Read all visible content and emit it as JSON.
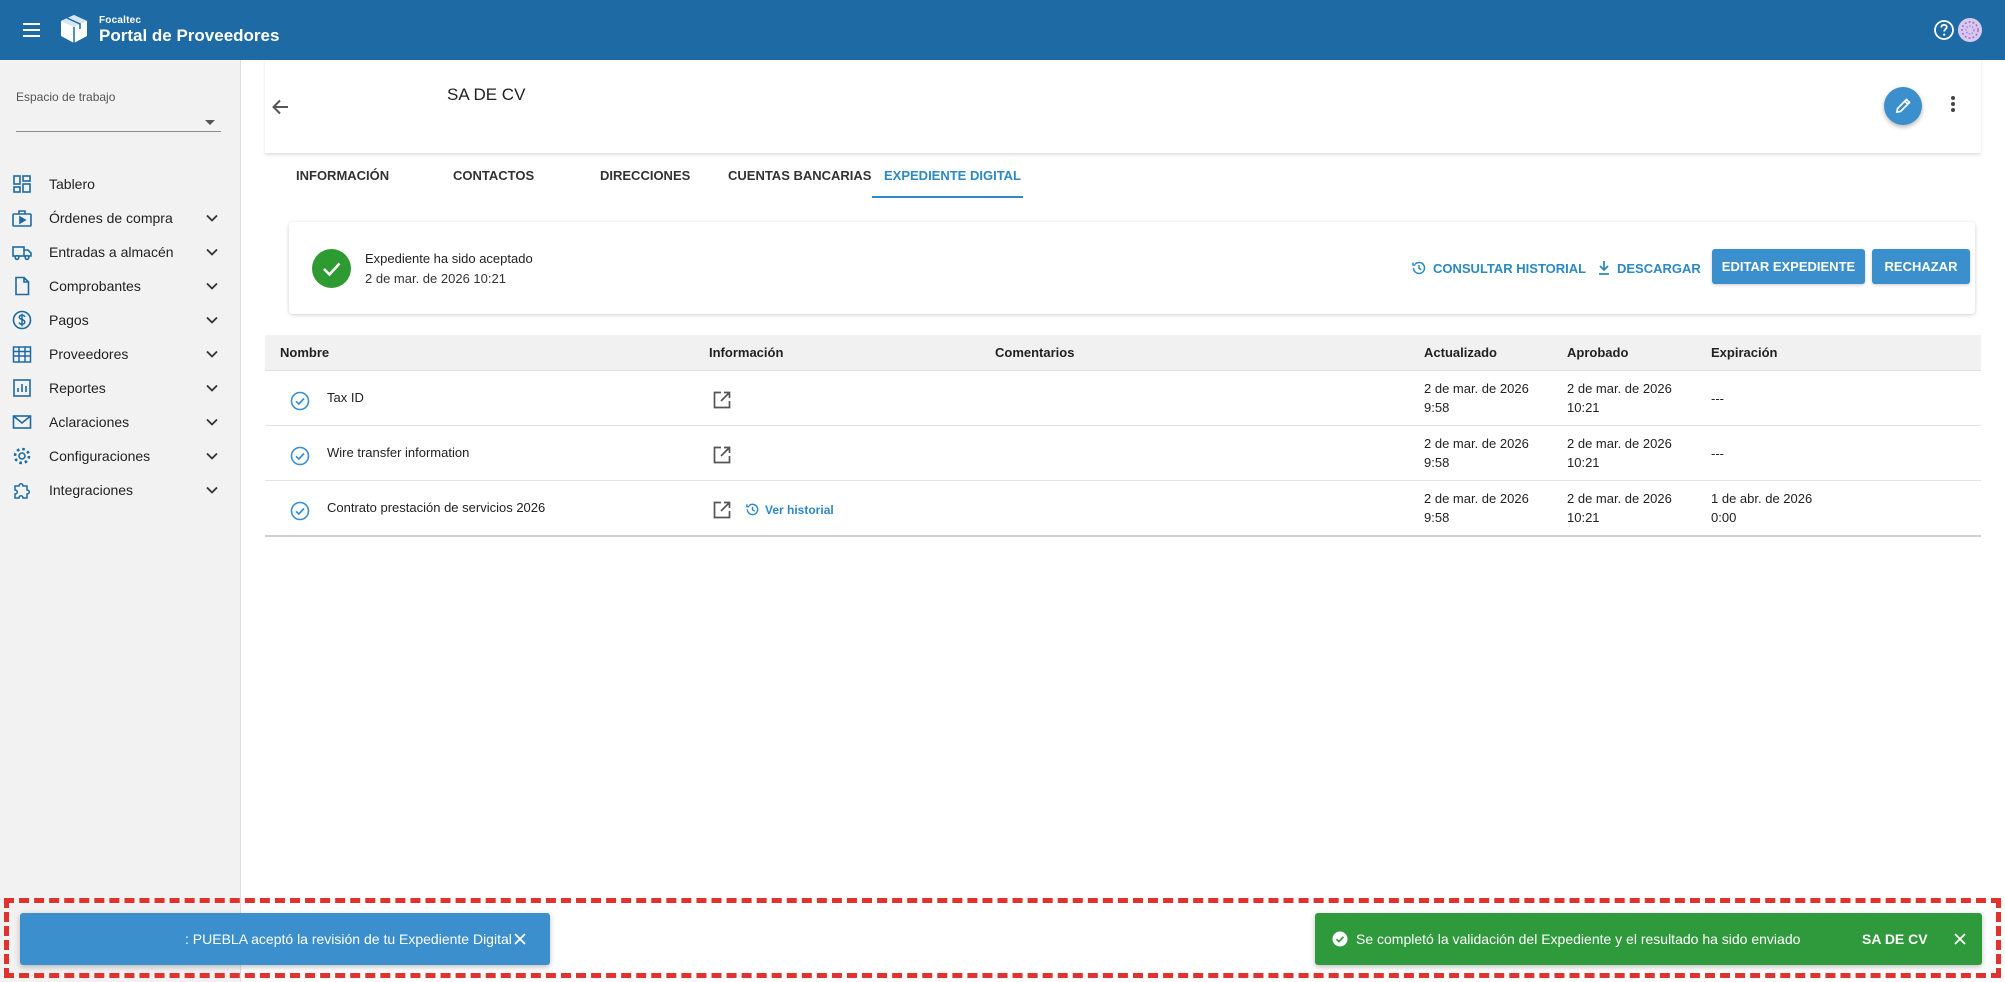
{
  "header": {
    "brand_small": "Focaltec",
    "brand_title": "Portal de Proveedores"
  },
  "sidebar": {
    "workspace_label": "Espacio de trabajo",
    "workspace_value": "",
    "items": [
      {
        "label": "Tablero",
        "icon": "dashboard-icon"
      },
      {
        "label": "Órdenes de compra",
        "icon": "purchase-orders-icon"
      },
      {
        "label": "Entradas a almacén",
        "icon": "truck-icon"
      },
      {
        "label": "Comprobantes",
        "icon": "document-icon"
      },
      {
        "label": "Pagos",
        "icon": "dollar-icon"
      },
      {
        "label": "Proveedores",
        "icon": "building-icon"
      },
      {
        "label": "Reportes",
        "icon": "report-icon"
      },
      {
        "label": "Aclaraciones",
        "icon": "mail-icon"
      },
      {
        "label": "Configuraciones",
        "icon": "gear-icon"
      },
      {
        "label": "Integraciones",
        "icon": "puzzle-icon"
      }
    ]
  },
  "page": {
    "title": "SA DE CV"
  },
  "tabs": [
    "INFORMACIÓN",
    "CONTACTOS",
    "DIRECCIONES",
    "CUENTAS BANCARIAS",
    "EXPEDIENTE DIGITAL"
  ],
  "status": {
    "title": "Expediente ha sido aceptado",
    "date": "2 de mar. de 2026 10:21",
    "history_btn": "CONSULTAR HISTORIAL",
    "download_btn": "DESCARGAR",
    "edit_btn": "EDITAR EXPEDIENTE",
    "reject_btn": "RECHAZAR"
  },
  "table": {
    "columns": [
      "Nombre",
      "Información",
      "Comentarios",
      "Actualizado",
      "Aprobado",
      "Expiración"
    ],
    "rows": [
      {
        "name": "Tax ID",
        "updated_1": "2 de mar. de 2026",
        "updated_2": "9:58",
        "approved_1": "2 de mar. de 2026",
        "approved_2": "10:21",
        "expiration_1": "---",
        "expiration_2": "",
        "history": ""
      },
      {
        "name": "Wire transfer information",
        "updated_1": "2 de mar. de 2026",
        "updated_2": "9:58",
        "approved_1": "2 de mar. de 2026",
        "approved_2": "10:21",
        "expiration_1": "---",
        "expiration_2": "",
        "history": ""
      },
      {
        "name": "Contrato prestación de servicios 2026",
        "updated_1": "2 de mar. de 2026",
        "updated_2": "9:58",
        "approved_1": "2 de mar. de 2026",
        "approved_2": "10:21",
        "expiration_1": "1 de abr. de 2026",
        "expiration_2": "0:00",
        "history": "Ver historial"
      }
    ]
  },
  "toasts": {
    "left_message": ": PUEBLA aceptó la revisión de tu Expediente Digital",
    "right_message": "Se completó la validación del Expediente y el resultado ha sido enviado",
    "right_action": "SA DE CV"
  },
  "colors": {
    "primary": "#1d6aa5",
    "accent": "#3a8fcc",
    "success": "#2e9a32",
    "highlight": "#e0332e"
  }
}
